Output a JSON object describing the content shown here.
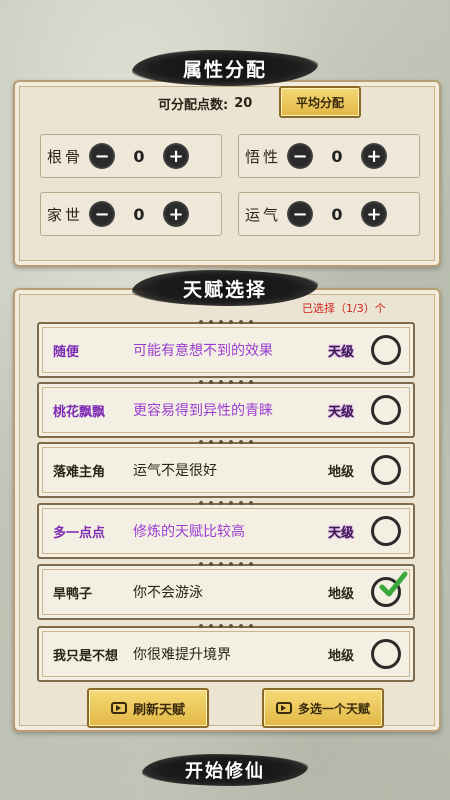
{
  "attributes": {
    "title": "属性分配",
    "points_label": "可分配点数:",
    "points_value": "20",
    "average_button": "平均分配",
    "stats": [
      {
        "label": "根骨",
        "value": "0"
      },
      {
        "label": "悟性",
        "value": "0"
      },
      {
        "label": "家世",
        "value": "0"
      },
      {
        "label": "运气",
        "value": "0"
      }
    ],
    "minus_symbol": "−",
    "plus_symbol": "+"
  },
  "talents": {
    "title": "天赋选择",
    "selected_count": "已选择（1/3）个",
    "items": [
      {
        "name": "随便",
        "description": "可能有意想不到的效果",
        "grade": "天级",
        "style": "purple",
        "checked": false
      },
      {
        "name": "桃花飘飘",
        "description": "更容易得到异性的青睐",
        "grade": "天级",
        "style": "purple",
        "checked": false
      },
      {
        "name": "落难主角",
        "description": "运气不是很好",
        "grade": "地级",
        "style": "plain",
        "checked": false
      },
      {
        "name": "多一点点",
        "description": "修炼的天赋比较高",
        "grade": "天级",
        "style": "purple",
        "checked": false
      },
      {
        "name": "旱鸭子",
        "description": "你不会游泳",
        "grade": "地级",
        "style": "plain",
        "checked": true
      },
      {
        "name": "我只是不想",
        "description": "你很难提升境界",
        "grade": "地级",
        "style": "plain",
        "checked": false
      }
    ],
    "refresh_button": "刷新天赋",
    "multi_button": "多选一个天赋"
  },
  "start_button": "开始修仙",
  "colors": {
    "talent_purple": "#9b3fd1",
    "selected_red": "#d0211f",
    "check_green": "#3aa83a",
    "gold": "#e2b745"
  },
  "icons": {
    "video": "video-icon",
    "check": "checkmark-icon"
  }
}
